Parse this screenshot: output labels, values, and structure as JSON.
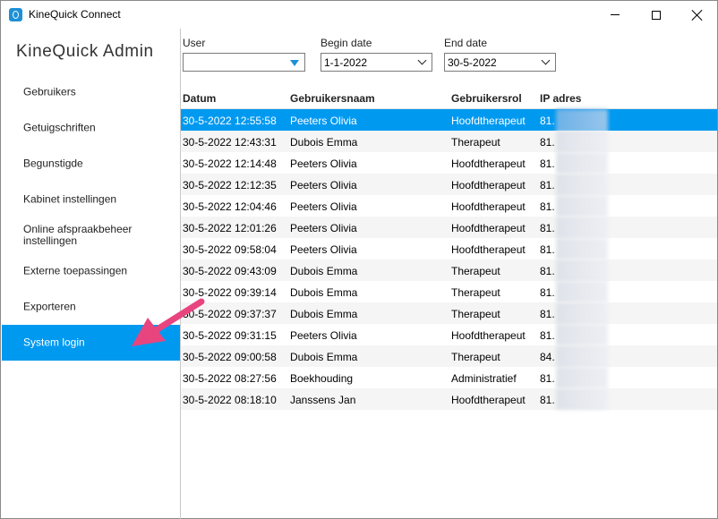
{
  "window": {
    "title": "KineQuick Connect"
  },
  "sidebar": {
    "title": "KineQuick Admin",
    "items": [
      {
        "label": "Gebruikers"
      },
      {
        "label": "Getuigschriften"
      },
      {
        "label": "Begunstigde"
      },
      {
        "label": "Kabinet instellingen"
      },
      {
        "label": "Online afspraakbeheer instellingen"
      },
      {
        "label": "Externe toepassingen"
      },
      {
        "label": "Exporteren"
      },
      {
        "label": "System login",
        "active": true
      }
    ]
  },
  "filters": {
    "user": {
      "label": "User",
      "value": ""
    },
    "begin_date": {
      "label": "Begin date",
      "value": "1-1-2022"
    },
    "end_date": {
      "label": "End date",
      "value": "30-5-2022"
    }
  },
  "table": {
    "headers": [
      "Datum",
      "Gebruikersnaam",
      "Gebruikersrol",
      "IP adres"
    ],
    "rows": [
      [
        "30-5-2022 12:55:58",
        "Peeters Olivia",
        "Hoofdtherapeut",
        "81."
      ],
      [
        "30-5-2022 12:43:31",
        "Dubois Emma",
        "Therapeut",
        "81."
      ],
      [
        "30-5-2022 12:14:48",
        "Peeters Olivia",
        "Hoofdtherapeut",
        "81."
      ],
      [
        "30-5-2022 12:12:35",
        "Peeters Olivia",
        "Hoofdtherapeut",
        "81."
      ],
      [
        "30-5-2022 12:04:46",
        "Peeters Olivia",
        "Hoofdtherapeut",
        "81."
      ],
      [
        "30-5-2022 12:01:26",
        "Peeters Olivia",
        "Hoofdtherapeut",
        "81."
      ],
      [
        "30-5-2022 09:58:04",
        "Peeters Olivia",
        "Hoofdtherapeut",
        "81."
      ],
      [
        "30-5-2022 09:43:09",
        "Dubois Emma",
        "Therapeut",
        "81."
      ],
      [
        "30-5-2022 09:39:14",
        "Dubois Emma",
        "Therapeut",
        "81."
      ],
      [
        "30-5-2022 09:37:37",
        "Dubois Emma",
        "Therapeut",
        "81."
      ],
      [
        "30-5-2022 09:31:15",
        "Peeters Olivia",
        "Hoofdtherapeut",
        "81."
      ],
      [
        "30-5-2022 09:00:58",
        "Dubois Emma",
        "Therapeut",
        "84."
      ],
      [
        "30-5-2022 08:27:56",
        "Boekhouding",
        "Administratief",
        "81."
      ],
      [
        "30-5-2022 08:18:10",
        "Janssens Jan",
        "Hoofdtherapeut",
        "81."
      ]
    ],
    "selected_row": 0
  },
  "colors": {
    "accent": "#0099f0",
    "annotation_arrow": "#e8457f"
  },
  "icons": {
    "app": "kinequick-app-icon",
    "user_dropdown": "triangle-down-icon",
    "date_dropdown": "chevron-down-icon"
  }
}
